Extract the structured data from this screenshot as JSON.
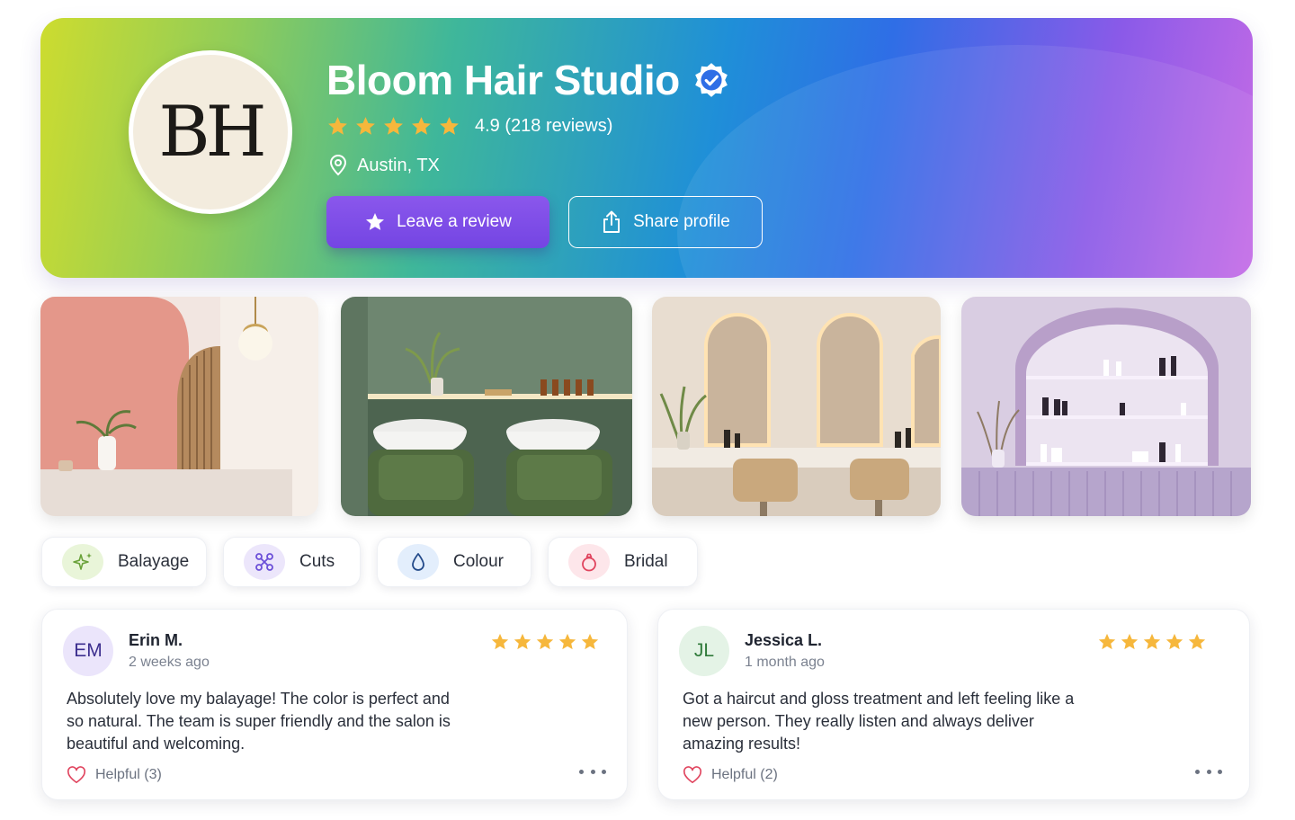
{
  "profile": {
    "logo_initials": "BH",
    "name": "Bloom Hair Studio",
    "verified": true,
    "rating_value": "4.9",
    "rating_text": "4.9 (218 reviews)",
    "stars": 5,
    "location": "Austin, TX",
    "leave_review_label": "Leave a review",
    "share_label": "Share profile"
  },
  "gallery": [
    {
      "subject": "pink salon corner with pendant lamp"
    },
    {
      "subject": "green wash stations"
    },
    {
      "subject": "arched backlit mirrors with styling chairs"
    },
    {
      "subject": "lilac product display shelf"
    }
  ],
  "categories": [
    {
      "label": "Balayage",
      "icon": "sparkle-icon",
      "color": "#e9f5d9"
    },
    {
      "label": "Cuts",
      "icon": "scissors-icon",
      "color": "#ece6fb"
    },
    {
      "label": "Colour",
      "icon": "droplet-icon",
      "color": "#e3eefc"
    },
    {
      "label": "Bridal",
      "icon": "ring-icon",
      "color": "#fde6ea"
    }
  ],
  "reviews": [
    {
      "initials": "EM",
      "name": "Erin M.",
      "time": "2 weeks ago",
      "stars": 5,
      "text": "Absolutely love my balayage! The color is perfect and so natural. The team is super friendly and the salon is beautiful and welcoming.",
      "helpful": "Helpful (3)"
    },
    {
      "initials": "JL",
      "name": "Jessica L.",
      "time": "1 month ago",
      "stars": 5,
      "text": "Got a haircut and gloss treatment and left feeling like a new person. They really listen and always deliver amazing results!",
      "helpful": "Helpful (2)"
    }
  ],
  "colors": {
    "accent_purple": "#7c4ce6",
    "star_gold": "#f6b73c",
    "verified_blue": "#2f6ee6"
  }
}
